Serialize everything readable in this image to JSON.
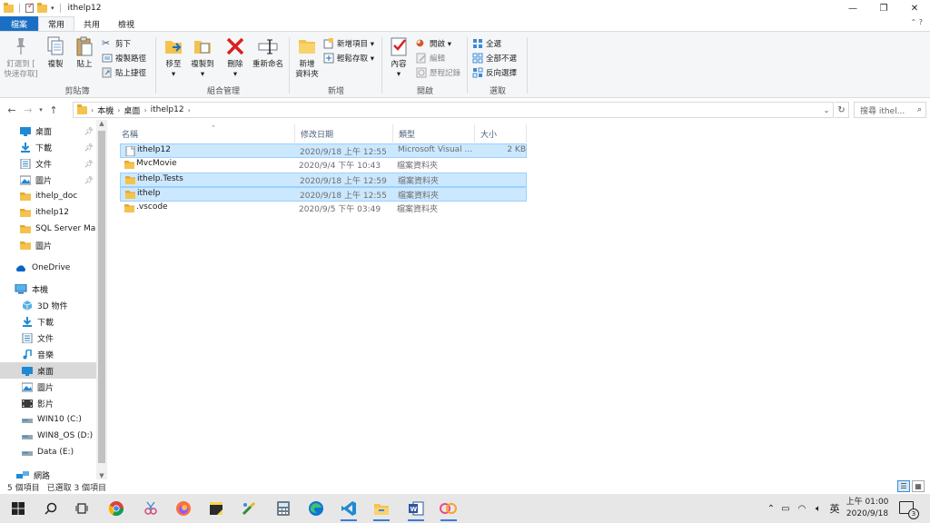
{
  "window": {
    "title": "ithelp12",
    "controls": {
      "minimize": "—",
      "maximize": "❐",
      "close": "✕"
    }
  },
  "ribbon_tabs": {
    "file": "檔案",
    "home": "常用",
    "share": "共用",
    "view": "檢視"
  },
  "ribbon": {
    "clipboard": {
      "label": "剪貼簿",
      "pin": "釘選到 [\n快速存取]",
      "copy": "複製",
      "paste": "貼上",
      "cut": "剪下",
      "copy_path": "複製路徑",
      "paste_shortcut": "貼上捷徑"
    },
    "organize": {
      "label": "組合管理",
      "move_to": "移至",
      "copy_to": "複製到",
      "delete": "刪除",
      "rename": "重新命名"
    },
    "new": {
      "label": "新增",
      "new_folder": "新增\n資料夾",
      "new_item": "新增項目",
      "easy_access": "輕鬆存取"
    },
    "open": {
      "label": "開啟",
      "properties": "內容",
      "open": "開啟",
      "edit": "編輯",
      "history": "歷程記錄"
    },
    "select": {
      "label": "選取",
      "select_all": "全選",
      "select_none": "全部不選",
      "invert": "反向選擇"
    }
  },
  "address": {
    "crumbs": [
      "本機",
      "桌面",
      "ithelp12"
    ],
    "search_placeholder": "搜尋 ithel..."
  },
  "nav_pane": {
    "quick_access": [
      {
        "label": "桌面",
        "icon": "desktop-icon",
        "pinned": true
      },
      {
        "label": "下載",
        "icon": "download-icon",
        "pinned": true
      },
      {
        "label": "文件",
        "icon": "document-icon",
        "pinned": true
      },
      {
        "label": "圖片",
        "icon": "picture-icon",
        "pinned": true
      },
      {
        "label": "ithelp_doc",
        "icon": "folder-icon",
        "pinned": false
      },
      {
        "label": "ithelp12",
        "icon": "folder-icon",
        "pinned": false
      },
      {
        "label": "SQL Server Mar",
        "icon": "folder-icon",
        "pinned": false
      },
      {
        "label": "圖片",
        "icon": "folder-icon",
        "pinned": false
      }
    ],
    "onedrive": "OneDrive",
    "this_pc": "本機",
    "pc_items": [
      {
        "label": "3D 物件",
        "icon": "3d-objects-icon"
      },
      {
        "label": "下載",
        "icon": "download-icon"
      },
      {
        "label": "文件",
        "icon": "document-icon"
      },
      {
        "label": "音樂",
        "icon": "music-icon"
      },
      {
        "label": "桌面",
        "icon": "desktop-icon",
        "selected": true
      },
      {
        "label": "圖片",
        "icon": "picture-icon"
      },
      {
        "label": "影片",
        "icon": "video-icon"
      },
      {
        "label": "WIN10 (C:)",
        "icon": "drive-icon"
      },
      {
        "label": "WIN8_OS (D:)",
        "icon": "drive-icon"
      },
      {
        "label": "Data (E:)",
        "icon": "drive-icon"
      }
    ],
    "network": "網路"
  },
  "columns": {
    "name": "名稱",
    "date": "修改日期",
    "type": "類型",
    "size": "大小"
  },
  "files": [
    {
      "name": "ithelp12",
      "date": "2020/9/18 上午 12:55",
      "type": "Microsoft Visual ...",
      "size": "2 KB",
      "icon": "solution-file-icon",
      "selected": true
    },
    {
      "name": "MvcMovie",
      "date": "2020/9/4 下午 10:43",
      "type": "檔案資料夾",
      "size": "",
      "icon": "folder-icon",
      "selected": false
    },
    {
      "name": "ithelp.Tests",
      "date": "2020/9/18 上午 12:59",
      "type": "檔案資料夾",
      "size": "",
      "icon": "folder-icon",
      "selected": true
    },
    {
      "name": "ithelp",
      "date": "2020/9/18 上午 12:55",
      "type": "檔案資料夾",
      "size": "",
      "icon": "folder-icon",
      "selected": true
    },
    {
      "name": ".vscode",
      "date": "2020/9/5 下午 03:49",
      "type": "檔案資料夾",
      "size": "",
      "icon": "folder-icon",
      "selected": false
    }
  ],
  "status": {
    "count": "5 個項目",
    "selected": "已選取 3 個項目"
  },
  "taskbar": {
    "apps": [
      "start-icon",
      "search-icon",
      "task-view-icon",
      "chrome-icon",
      "snipping-icon",
      "firefox-icon",
      "sticky-notes-icon",
      "paint-icon",
      "calculator-icon",
      "edge-icon",
      "vscode-icon",
      "file-explorer-icon",
      "word-icon",
      "pinwheel-icon"
    ],
    "ime": "英",
    "time": "上午 01:00",
    "date": "2020/9/18",
    "notifications": "3"
  },
  "colors": {
    "file_tab": "#1a6fc4",
    "selection": "#cce8ff",
    "selection_border": "#99d1ff",
    "folder": "#f4c34f"
  }
}
